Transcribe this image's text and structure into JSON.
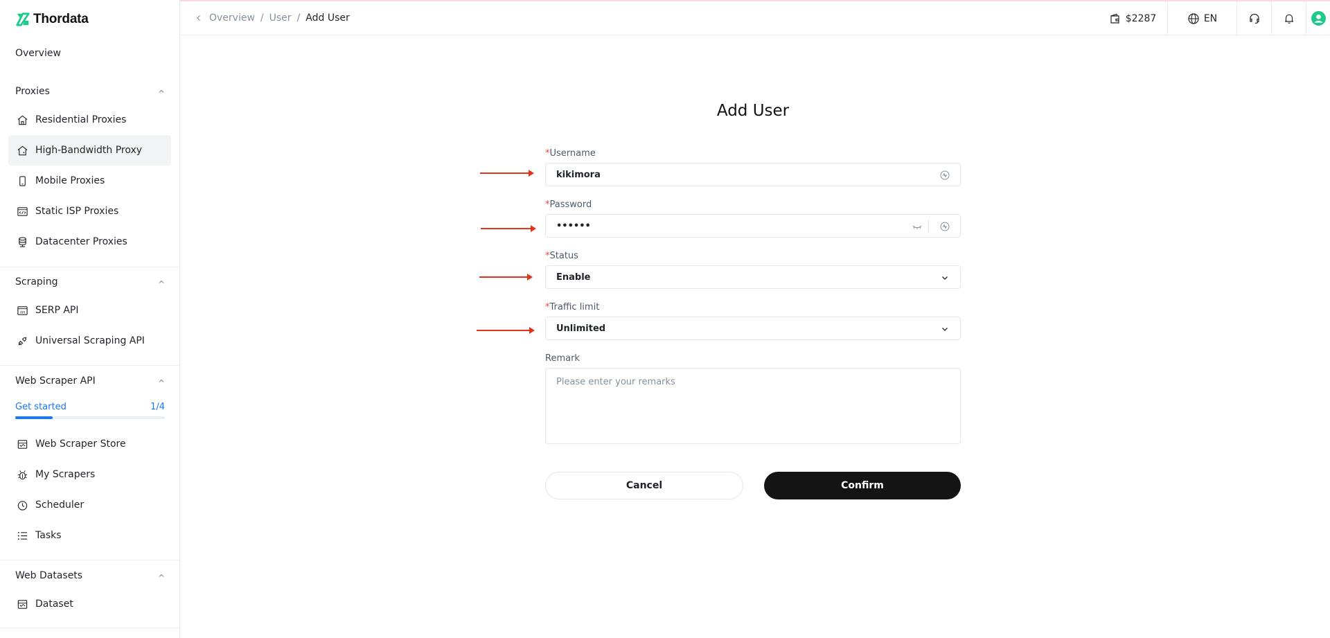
{
  "brand": {
    "name": "Thordata",
    "accent": "#1ec98a"
  },
  "breadcrumb": {
    "items": [
      "Overview",
      "User"
    ],
    "current": "Add User"
  },
  "header": {
    "balance": "$2287",
    "language": "EN"
  },
  "sidebar": {
    "overview": "Overview",
    "proxies": {
      "title": "Proxies",
      "items": [
        "Residential Proxies",
        "High-Bandwidth Proxy",
        "Mobile Proxies",
        "Static ISP Proxies",
        "Datacenter Proxies"
      ],
      "active": "High-Bandwidth Proxy"
    },
    "scraping": {
      "title": "Scraping",
      "items": [
        "SERP API",
        "Universal Scraping API"
      ]
    },
    "web_scraper_api": {
      "title": "Web Scraper API",
      "get_started": {
        "label": "Get started",
        "progress_text": "1/4",
        "progress_fraction": 0.25
      },
      "items": [
        "Web Scraper Store",
        "My Scrapers",
        "Scheduler",
        "Tasks"
      ]
    },
    "web_datasets": {
      "title": "Web Datasets",
      "items": [
        "Dataset"
      ]
    }
  },
  "form": {
    "title": "Add User",
    "required_mark": "*",
    "username": {
      "label": "Username",
      "value": "kikimora"
    },
    "password": {
      "label": "Password",
      "value": "••••••"
    },
    "status": {
      "label": "Status",
      "value": "Enable"
    },
    "traffic_limit": {
      "label": "Traffic limit",
      "value": "Unlimited"
    },
    "remark": {
      "label": "Remark",
      "placeholder": "Please enter your remarks"
    },
    "cancel_label": "Cancel",
    "confirm_label": "Confirm"
  },
  "colors": {
    "annotation_arrow": "#e2331b",
    "link_blue": "#1677ff",
    "required_red": "#f53f3f"
  }
}
